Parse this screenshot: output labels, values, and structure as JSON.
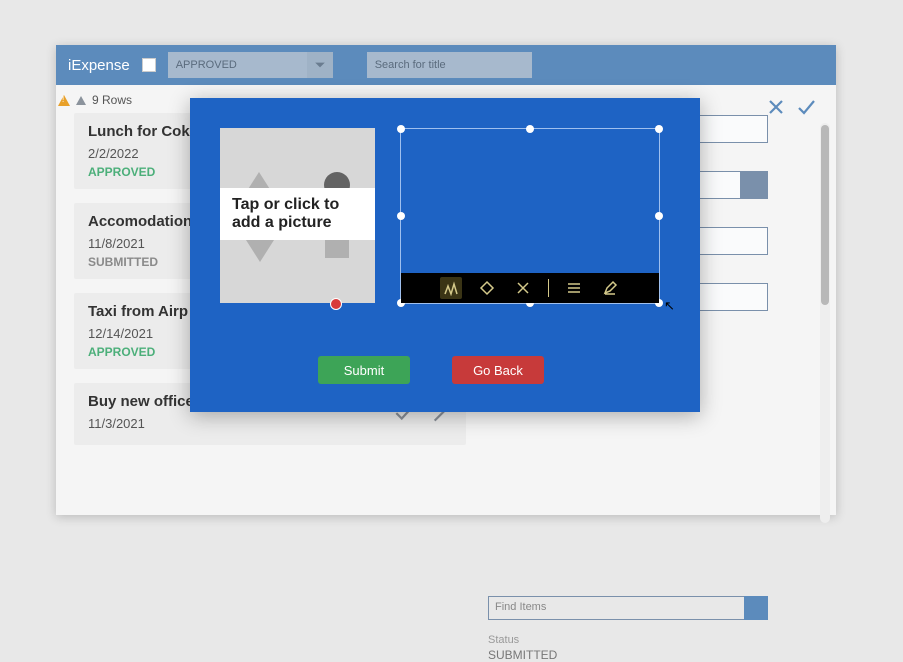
{
  "header": {
    "title": "iExpense",
    "filter_selected": "APPROVED",
    "search_placeholder": "Search for title"
  },
  "rows_summary": "9 Rows",
  "rows": [
    {
      "title": "Lunch for Coke",
      "date": "2/2/2022",
      "status": "APPROVED",
      "status_class": "approved"
    },
    {
      "title": "Accomodation",
      "date": "11/8/2021",
      "status": "SUBMITTED",
      "status_class": "submitted"
    },
    {
      "title": "Taxi from Airp",
      "date": "12/14/2021",
      "status": "APPROVED",
      "status_class": "approved"
    },
    {
      "title": "Buy new office supplies for the team",
      "date": "11/3/2021",
      "status": "",
      "status_class": ""
    }
  ],
  "detail": {
    "find_placeholder": "Find Items",
    "status_label": "Status",
    "status_value": "SUBMITTED"
  },
  "modal": {
    "picture_prompt": "Tap or click to add a picture",
    "submit_label": "Submit",
    "goback_label": "Go Back"
  }
}
